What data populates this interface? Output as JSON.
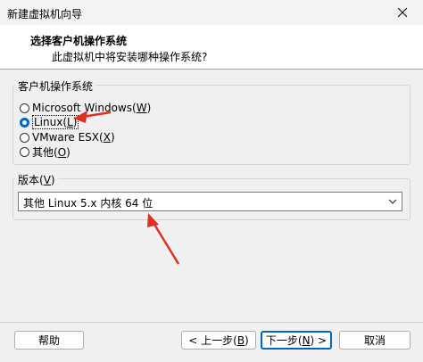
{
  "window": {
    "title": "新建虚拟机向导"
  },
  "header": {
    "title": "选择客户机操作系统",
    "subtitle": "此虚拟机中将安装哪种操作系统?"
  },
  "guest_os_group": {
    "legend": "客户机操作系统",
    "options": [
      {
        "label": "Microsoft Windows",
        "accel": "W",
        "checked": false
      },
      {
        "label": "Linux",
        "accel": "L",
        "checked": true
      },
      {
        "label": "VMware ESX",
        "accel": "X",
        "checked": false
      },
      {
        "label": "其他",
        "accel": "O",
        "checked": false
      }
    ]
  },
  "version_group": {
    "legend": "版本",
    "accel": "V",
    "selected": "其他 Linux 5.x 内核 64 位"
  },
  "footer": {
    "help_label": "帮助",
    "back_label": "< 上一步(",
    "back_accel": "B",
    "back_suffix": ")",
    "next_label": "下一步(",
    "next_accel": "N",
    "next_suffix": ") >",
    "cancel_label": "取消"
  },
  "annotation_color": "#e03020"
}
